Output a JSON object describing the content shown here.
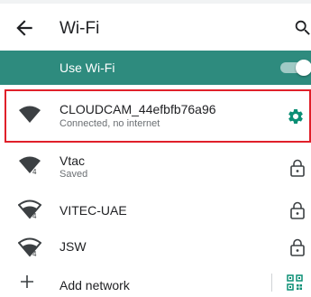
{
  "appbar": {
    "title": "Wi-Fi",
    "back_icon": "arrow-back-icon",
    "search_icon": "search-icon"
  },
  "use_wifi": {
    "label": "Use Wi-Fi",
    "enabled": true,
    "bar_color": "#2e8b7e"
  },
  "networks": [
    {
      "name": "CLOUDCAM_44efbfb76a96",
      "status": "Connected, no internet",
      "trailing_icon": "gear-icon",
      "highlighted": true,
      "highlight_color": "#e0202a"
    },
    {
      "name": "Vtac",
      "status": "Saved",
      "trailing_icon": "lock-icon",
      "signal_badge": "4"
    },
    {
      "name": "VITEC-UAE",
      "status": "",
      "trailing_icon": "lock-icon",
      "signal_badge": "4"
    },
    {
      "name": "JSW",
      "status": "",
      "trailing_icon": "lock-icon",
      "signal_badge": "4"
    }
  ],
  "add_network": {
    "label": "Add network",
    "leading_icon": "plus-icon",
    "trailing_icon": "qr-code-icon"
  },
  "accent_color": "#0b8f75"
}
